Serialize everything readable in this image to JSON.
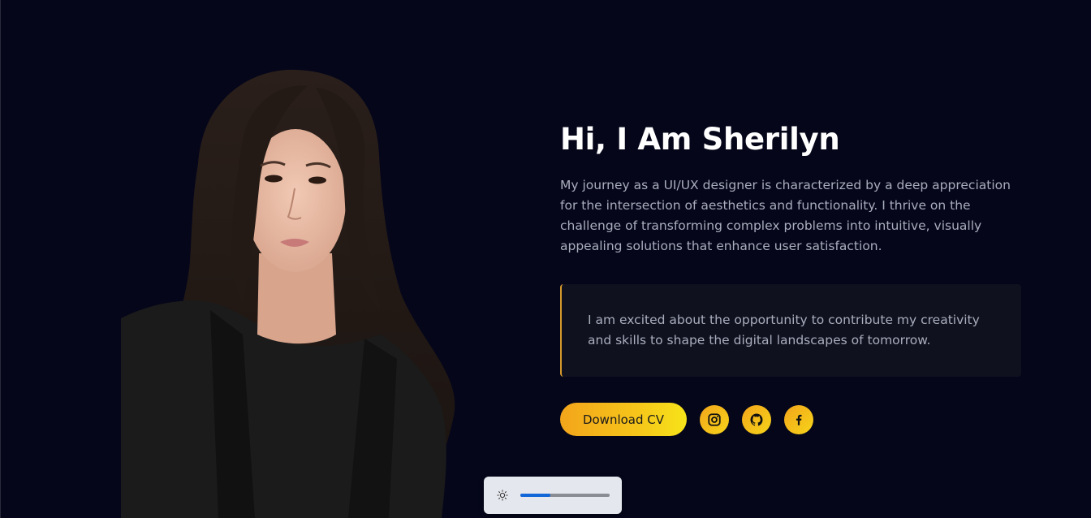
{
  "hero": {
    "title": "Hi, I Am Sherilyn",
    "bio": "My journey as a UI/UX designer is characterized by a deep appreciation for the intersection of aesthetics and functionality. I thrive on the challenge of transforming complex problems into intuitive, visually appealing solutions that enhance user satisfaction.",
    "quote": "I am excited about the opportunity to contribute my creativity and skills to shape the digital landscapes of tomorrow."
  },
  "actions": {
    "download_cv_label": "Download CV",
    "social": [
      {
        "icon": "instagram-icon"
      },
      {
        "icon": "github-icon"
      },
      {
        "icon": "facebook-icon"
      }
    ]
  },
  "brightness": {
    "icon": "sun-icon",
    "level": 0.34
  },
  "colors": {
    "background": "#05061a",
    "accent_start": "#f3a51b",
    "accent_end": "#f7e41a",
    "quote_border": "#d79a2c",
    "body_text": "#a9adbc",
    "slider_fill": "#1166d8"
  }
}
